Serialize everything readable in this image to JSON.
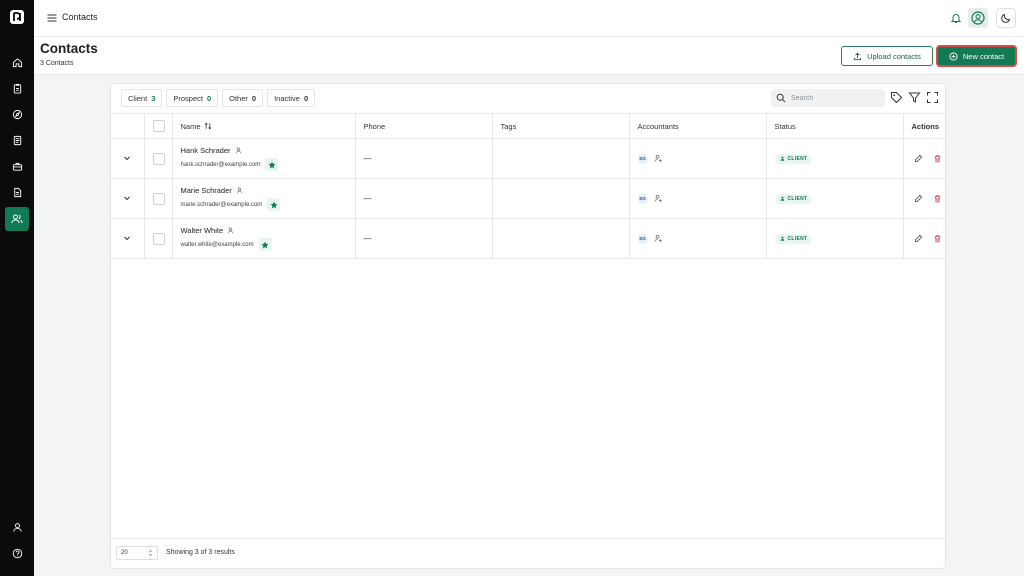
{
  "app": {
    "logo_icon": "logo-icon"
  },
  "sidebar": {
    "items": [
      {
        "name": "home",
        "icon": "home-icon",
        "active": false
      },
      {
        "name": "clients",
        "icon": "clipboard-icon",
        "active": false
      },
      {
        "name": "explore",
        "icon": "compass-icon",
        "active": false
      },
      {
        "name": "documents",
        "icon": "list-document-icon",
        "active": false
      },
      {
        "name": "briefcase",
        "icon": "briefcase-icon",
        "active": false
      },
      {
        "name": "files",
        "icon": "file-icon",
        "active": false
      },
      {
        "name": "contacts",
        "icon": "users-icon",
        "active": true
      }
    ],
    "bottom": [
      {
        "name": "profile",
        "icon": "user-icon"
      },
      {
        "name": "help",
        "icon": "help-icon"
      }
    ]
  },
  "topbar": {
    "title": "Contacts"
  },
  "page": {
    "title": "Contacts",
    "subtitle": "3 Contacts",
    "upload_label": "Upload contacts",
    "new_label": "New contact"
  },
  "filters": [
    {
      "label": "Client",
      "count": "3"
    },
    {
      "label": "Prospect",
      "count": "0"
    },
    {
      "label": "Other",
      "count": "0"
    },
    {
      "label": "Inactive",
      "count": "0"
    }
  ],
  "search": {
    "placeholder": "Search"
  },
  "table": {
    "headers": {
      "name": "Name",
      "phone": "Phone",
      "tags": "Tags",
      "accountants": "Accountants",
      "status": "Status",
      "actions": "Actions"
    },
    "rows": [
      {
        "name": "Hank Schrader",
        "email": "hank.schrader@example.com",
        "phone": "—",
        "tags": "",
        "accountant": "SG",
        "status": "CLIENT"
      },
      {
        "name": "Marie Schrader",
        "email": "marie.schrader@example.com",
        "phone": "—",
        "tags": "",
        "accountant": "SG",
        "status": "CLIENT"
      },
      {
        "name": "Walter White",
        "email": "walter.white@example.com",
        "phone": "—",
        "tags": "",
        "accountant": "SG",
        "status": "CLIENT"
      }
    ]
  },
  "footer": {
    "page_size": "20",
    "results_text": "Showing 3 of 3 results"
  },
  "colors": {
    "brand_green": "#137a56",
    "delete_red": "#d14545",
    "sidebar_bg": "#0b0b0b"
  }
}
